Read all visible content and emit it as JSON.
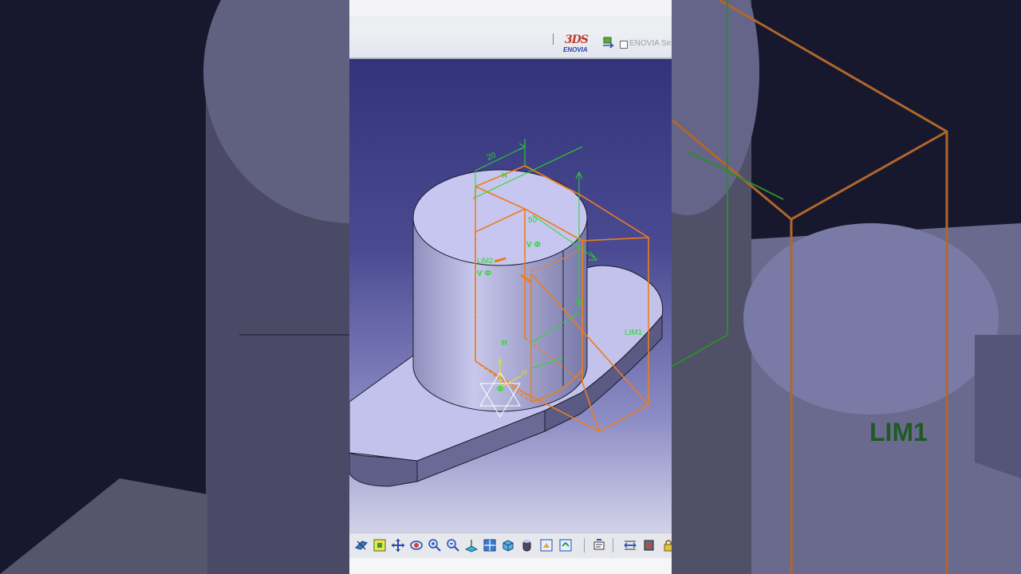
{
  "header": {
    "brand_logo_text": "ENOVIA",
    "search_label": "ENOVIA Sea"
  },
  "dimensions": {
    "width_value": "20",
    "length_value": "50"
  },
  "constraints": {
    "h_marker": "H",
    "v_marker": "V",
    "phi_marker": "Φ",
    "v_phi_label": "V Φ",
    "lim2_label": "LIM2",
    "lim1_label": "LIM1",
    "axis_h_label": "H",
    "axis_v_label": "V"
  },
  "background_right": {
    "lim1_label": "LIM1"
  },
  "toolbar": {
    "icons": [
      "fly-mode-icon",
      "fit-all-icon",
      "pan-icon",
      "rotate-icon",
      "zoom-in-icon",
      "zoom-out-icon",
      "normal-view-icon",
      "multi-view-icon",
      "isometric-view-icon",
      "shading-icon",
      "hide-show-icon",
      "swap-space-icon",
      "sketch-icon",
      "measure-icon",
      "apply-material-icon",
      "lock-icon"
    ]
  },
  "colors": {
    "viewport_top": "#33337a",
    "viewport_bottom": "#d2d2ea",
    "part_face": "#c4c4ee",
    "sketch_orange": "#ee7d1c",
    "constraint_green": "#22dd22"
  }
}
